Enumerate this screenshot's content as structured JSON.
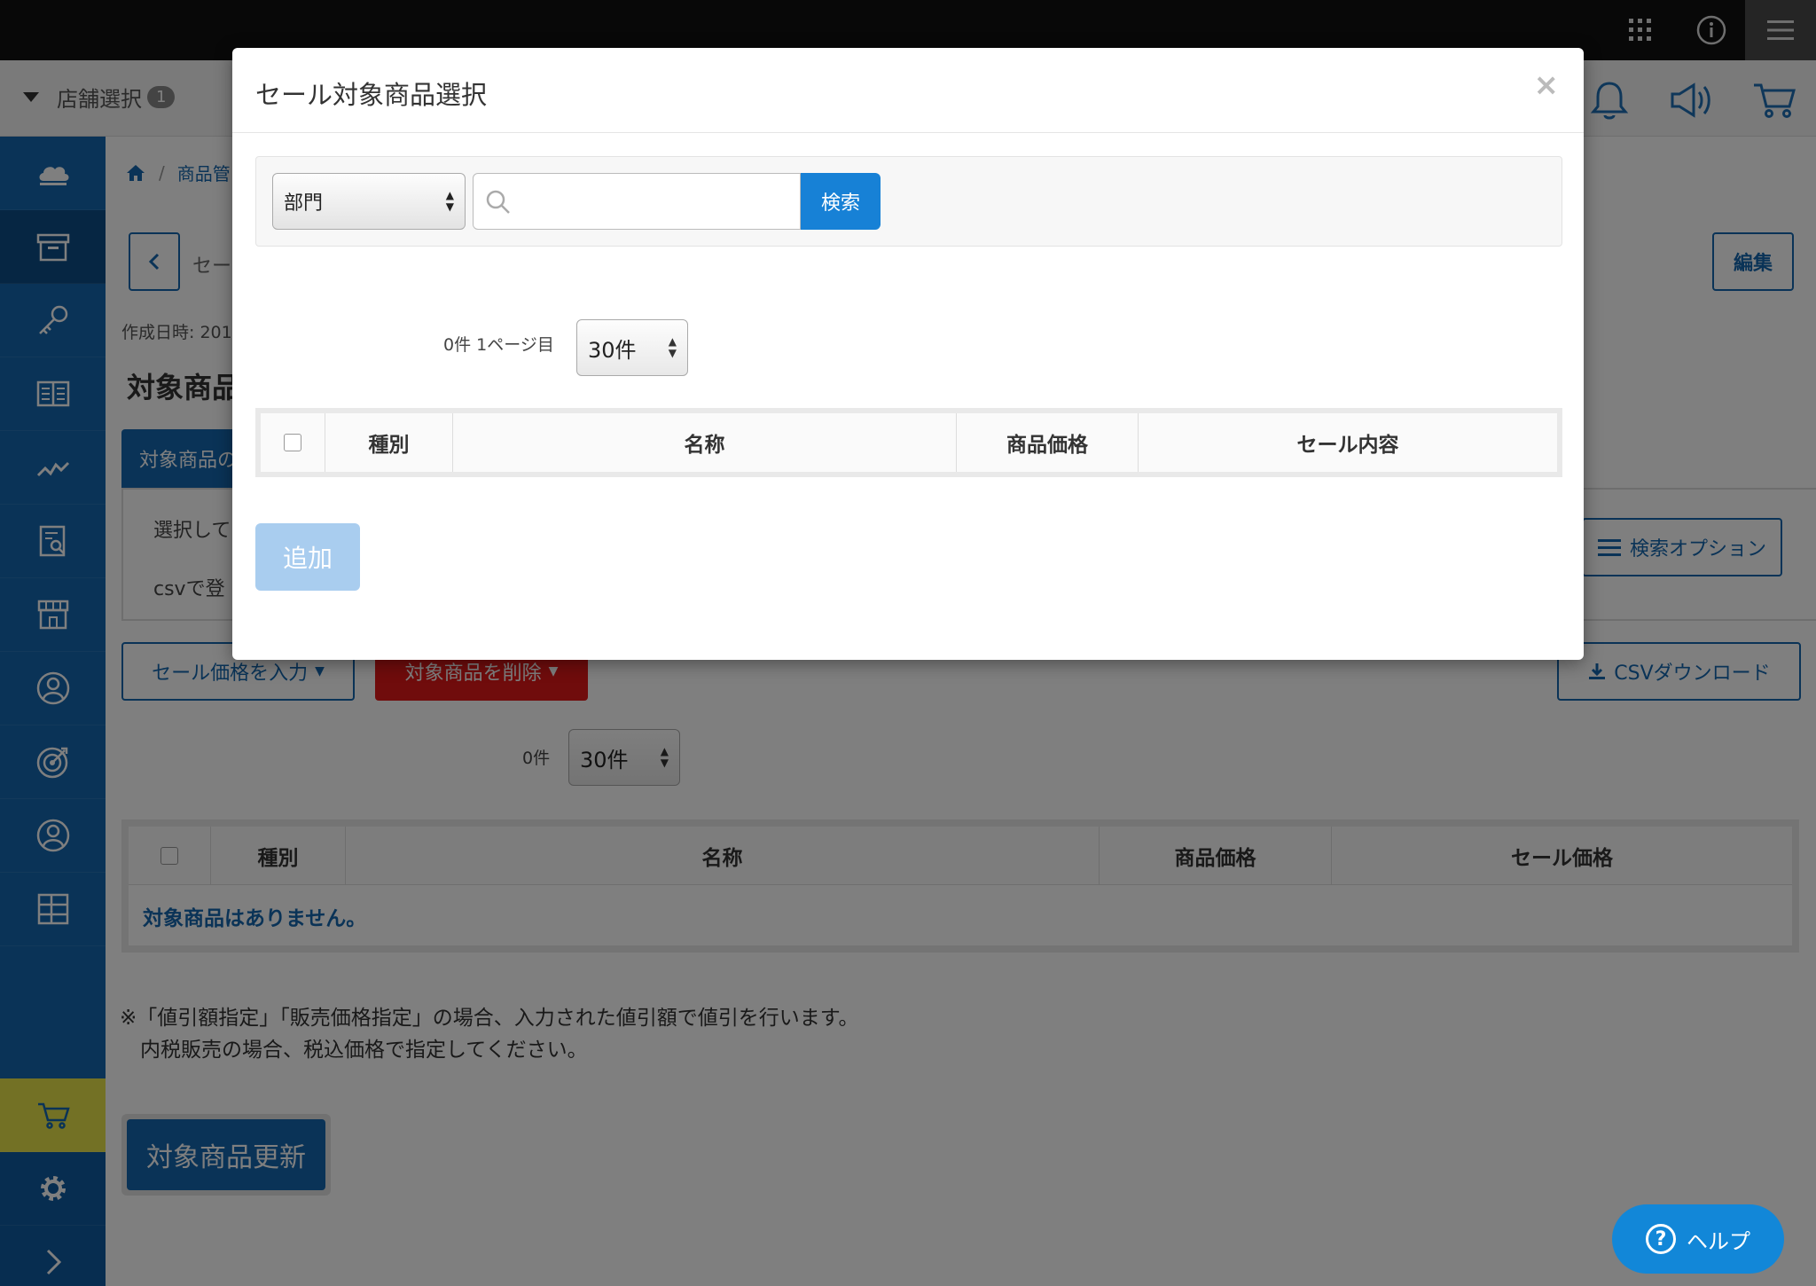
{
  "header": {
    "store_select_label": "店舗選択",
    "store_count": "1"
  },
  "main": {
    "breadcrumb_item": "商品管",
    "page_subtitle": "セー",
    "edit_label": "編集",
    "created_label": "作成日時: 201",
    "section_title": "対象商品",
    "tab_label": "対象商品の",
    "options": [
      "選択して",
      "csvで登"
    ],
    "search_option_label": "検索オプション",
    "sale_price_button": "セール価格を入力",
    "delete_button": "対象商品を削除",
    "csv_button": "CSVダウンロード",
    "count_label": "0件",
    "per_page": "30件",
    "table_headers": [
      "種別",
      "名称",
      "商品価格",
      "セール価格"
    ],
    "empty_message": "対象商品はありません。",
    "note_lines": [
      "※「値引額指定」「販売価格指定」の場合、入力された値引額で値引を行います。",
      "　内税販売の場合、税込価格で指定してください。"
    ],
    "update_button": "対象商品更新"
  },
  "help_label": "ヘルプ",
  "modal": {
    "title": "セール対象商品選択",
    "close": "×",
    "dept_select": "部門",
    "search_placeholder": "",
    "search_button": "検索",
    "count_label": "0件 1ページ目",
    "per_page": "30件",
    "table_headers": [
      "種別",
      "名称",
      "商品価格",
      "セール内容"
    ],
    "add_button": "追加"
  },
  "colors": {
    "brand": "#1466ae",
    "danger": "#e01818",
    "search": "#1781d6"
  }
}
